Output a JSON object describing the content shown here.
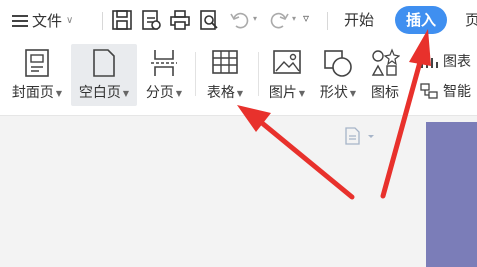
{
  "titlebar": {
    "file_menu_label": "文件",
    "tabs": {
      "start": "开始",
      "insert": "插入",
      "next": "页"
    }
  },
  "ribbon": {
    "cover_page": "封面页",
    "blank_page": "空白页",
    "page_break": "分页",
    "table": "表格",
    "picture": "图片",
    "shape": "形状",
    "icon": "图标",
    "chart": "图表",
    "smart": "智能"
  },
  "colors": {
    "accent": "#3f8ff0",
    "annotation_arrow": "#e8312c",
    "page_shape": "#7b7db8"
  }
}
